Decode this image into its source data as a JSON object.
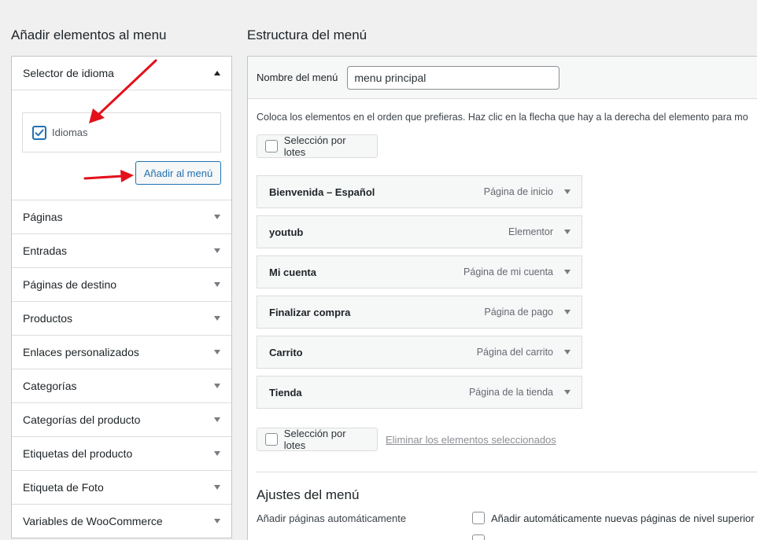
{
  "left": {
    "title": "Añadir elementos al menu",
    "selector": {
      "label": "Selector de idioma",
      "language_item": "Idiomas",
      "add_button": "Añadir al menú"
    },
    "sections": [
      "Páginas",
      "Entradas",
      "Páginas de destino",
      "Productos",
      "Enlaces personalizados",
      "Categorías",
      "Categorías del producto",
      "Etiquetas del producto",
      "Etiqueta de Foto",
      "Variables de WooCommerce"
    ]
  },
  "right": {
    "title": "Estructura del menú",
    "name_label": "Nombre del menú",
    "name_value": "menu principal",
    "instructions": "Coloca los elementos en el orden que prefieras. Haz clic en la flecha que hay a la derecha del elemento para mo",
    "bulk_select": "Selección por lotes",
    "delete_selected": "Eliminar los elementos seleccionados",
    "items": [
      {
        "title": "Bienvenida – Español",
        "type": "Página de inicio"
      },
      {
        "title": "youtub",
        "type": "Elementor"
      },
      {
        "title": "Mi cuenta",
        "type": "Página de mi cuenta"
      },
      {
        "title": "Finalizar compra",
        "type": "Página de pago"
      },
      {
        "title": "Carrito",
        "type": "Página del carrito"
      },
      {
        "title": "Tienda",
        "type": "Página de la tienda"
      }
    ],
    "settings": {
      "title": "Ajustes del menú",
      "auto_add_label": "Añadir páginas automáticamente",
      "auto_add_option": "Añadir automáticamente nuevas páginas de nivel superior a"
    }
  },
  "colors": {
    "accent": "#2271b1",
    "annotation_arrow": "#e3111b"
  }
}
